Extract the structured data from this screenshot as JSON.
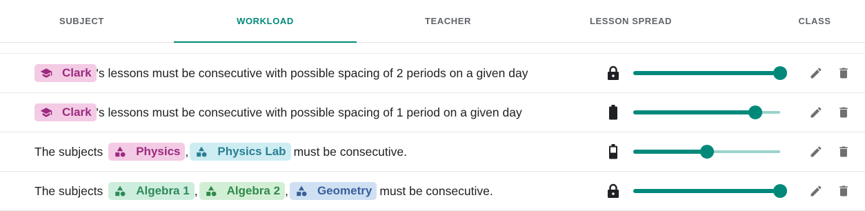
{
  "tabs": [
    {
      "label": "SUBJECT",
      "active": false
    },
    {
      "label": "WORKLOAD",
      "active": true
    },
    {
      "label": "TEACHER",
      "active": false
    },
    {
      "label": "LESSON SPREAD",
      "active": false
    },
    {
      "label": "CLASS",
      "active": false
    }
  ],
  "colors": {
    "accent": "#00897b",
    "accent_light": "#99d3cb",
    "icon_grey": "#707070"
  },
  "rules": [
    {
      "chips": [
        {
          "label": "Clark",
          "icon": "graduation-cap-icon"
        }
      ],
      "text": "'s lessons must be consecutive with possible spacing of 2 periods on a given day",
      "status_icon": "lock-icon",
      "weight": 1.0
    },
    {
      "chips": [
        {
          "label": "Clark",
          "icon": "graduation-cap-icon"
        }
      ],
      "text": "'s lessons must be consecutive with possible spacing of 1 period on a given day",
      "status_icon": "battery-icon",
      "weight": 0.83
    },
    {
      "prefix": "The subjects",
      "chips": [
        {
          "label": "Physics",
          "icon": "shapes-icon"
        },
        {
          "label": "Physics Lab",
          "icon": "shapes-icon"
        }
      ],
      "separator": ",",
      "text": "must be consecutive.",
      "status_icon": "battery-icon",
      "weight": 0.5
    },
    {
      "prefix": "The subjects",
      "chips": [
        {
          "label": "Algebra 1",
          "icon": "shapes-icon"
        },
        {
          "label": "Algebra 2",
          "icon": "shapes-icon"
        },
        {
          "label": "Geometry",
          "icon": "shapes-icon"
        }
      ],
      "separator": ",",
      "text": "must be consecutive.",
      "status_icon": "lock-icon",
      "weight": 1.0
    }
  ]
}
